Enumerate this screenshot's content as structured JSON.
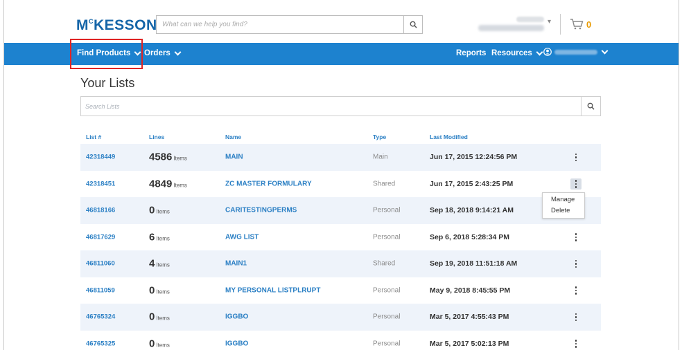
{
  "header": {
    "logo": "MCKESSON",
    "search_placeholder": "What can we help you find?",
    "cart_count": "0"
  },
  "nav": {
    "find_products": "Find Products",
    "orders": "Orders",
    "reports": "Reports",
    "resources": "Resources"
  },
  "page": {
    "title": "Your Lists",
    "search_placeholder": "Search Lists"
  },
  "table": {
    "columns": [
      "List #",
      "Lines",
      "Name",
      "Type",
      "Last Modified"
    ],
    "rows": [
      {
        "list": "42318449",
        "lines": "4586",
        "unit": "Items",
        "name": "MAIN",
        "type": "Main",
        "modified": "Jun 17, 2015 12:24:56 PM"
      },
      {
        "list": "42318451",
        "lines": "4849",
        "unit": "Items",
        "name": "ZC MASTER FORMULARY",
        "type": "Shared",
        "modified": "Jun 17, 2015 2:43:25 PM"
      },
      {
        "list": "46818166",
        "lines": "0",
        "unit": "Items",
        "name": "CARITESTINGPERMS",
        "type": "Personal",
        "modified": "Sep 18, 2018 9:14:21 AM"
      },
      {
        "list": "46817629",
        "lines": "6",
        "unit": "Items",
        "name": "AWG LIST",
        "type": "Personal",
        "modified": "Sep 6, 2018 5:28:34 PM"
      },
      {
        "list": "46811060",
        "lines": "4",
        "unit": "Items",
        "name": "MAIN1",
        "type": "Shared",
        "modified": "Sep 19, 2018 11:51:18 AM"
      },
      {
        "list": "46811059",
        "lines": "0",
        "unit": "Items",
        "name": "MY PERSONAL LISTPLRUPT",
        "type": "Personal",
        "modified": "May 9, 2018 8:45:55 PM"
      },
      {
        "list": "46765324",
        "lines": "0",
        "unit": "Items",
        "name": "IGGBO",
        "type": "Personal",
        "modified": "Mar 5, 2017 4:55:43 PM"
      },
      {
        "list": "46765325",
        "lines": "0",
        "unit": "Items",
        "name": "IGGBO",
        "type": "Personal",
        "modified": "Mar 5, 2017 5:02:13 PM"
      }
    ]
  },
  "context_menu": {
    "manage": "Manage",
    "delete": "Delete"
  },
  "colors": {
    "nav_blue": "#1d82cf",
    "link_blue": "#2a7fc4",
    "highlight_red": "#e02424",
    "cart_orange": "#e89a00"
  }
}
